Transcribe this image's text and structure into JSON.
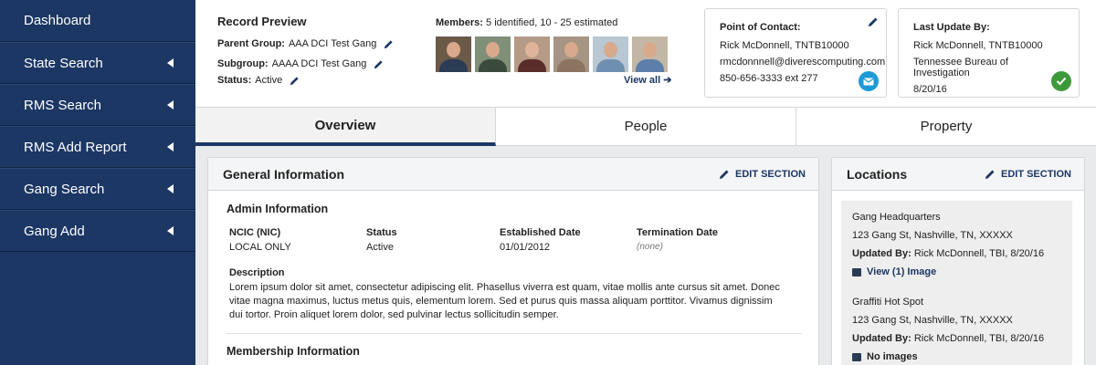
{
  "sidebar": {
    "items": [
      {
        "label": "Dashboard"
      },
      {
        "label": "State Search"
      },
      {
        "label": "RMS Search"
      },
      {
        "label": "RMS Add Report"
      },
      {
        "label": "Gang Search"
      },
      {
        "label": "Gang Add"
      }
    ]
  },
  "record": {
    "title": "Record Preview",
    "parent_label": "Parent Group:",
    "parent_value": "AAA DCI Test Gang",
    "subgroup_label": "Subgroup:",
    "subgroup_value": "AAAA DCI Test Gang",
    "status_label": "Status:",
    "status_value": "Active"
  },
  "members": {
    "label": "Members:",
    "value": "5 identified, 10 - 25 estimated",
    "view_all": "View all ➔"
  },
  "poc": {
    "title": "Point of Contact:",
    "name": "Rick McDonnell, TNTB10000",
    "email": "rmcdonnnell@diverescomputing.com",
    "phone": "850-656-3333 ext 277"
  },
  "last_update": {
    "title": "Last Update By:",
    "name": "Rick McDonnell, TNTB10000",
    "agency": "Tennessee Bureau of Investigation",
    "date": "8/20/16"
  },
  "tabs": [
    {
      "label": "Overview"
    },
    {
      "label": "People"
    },
    {
      "label": "Property"
    }
  ],
  "general": {
    "title": "General Information",
    "edit": "EDIT SECTION",
    "admin_title": "Admin Information",
    "ncic_label": "NCIC (NIC)",
    "ncic_value": "LOCAL ONLY",
    "status_label": "Status",
    "status_value": "Active",
    "established_label": "Established Date",
    "established_value": "01/01/2012",
    "termination_label": "Termination Date",
    "termination_value": "(none)",
    "description_label": "Description",
    "description": "Lorem ipsum dolor sit amet, consectetur adipiscing elit. Phasellus viverra est quam, vitae mollis ante cursus sit amet. Donec vitae magna maximus, luctus metus quis, elementum lorem. Sed et purus quis massa aliquam porttitor. Vivamus dignissim dui tortor. Proin aliquet lorem dolor, sed pulvinar lectus sollicitudin semper.",
    "membership_title": "Membership Information"
  },
  "locations": {
    "title": "Locations",
    "edit": "EDIT SECTION",
    "items": [
      {
        "name": "Gang Headquarters",
        "address": "123 Gang St, Nashville, TN, XXXXX",
        "updated_label": "Updated By:",
        "updated_value": "Rick McDonnell, TBI, 8/20/16",
        "image_text": "View (1) Image"
      },
      {
        "name": "Graffiti Hot Spot",
        "address": "123 Gang St, Nashville, TN, XXXXX",
        "updated_label": "Updated By:",
        "updated_value": "Rick McDonnell, TBI, 8/20/16",
        "image_text": "No images"
      }
    ]
  },
  "colors": {
    "navy": "#1c3764",
    "email_badge": "#1e9ad6",
    "check_badge": "#3d9a3a"
  }
}
